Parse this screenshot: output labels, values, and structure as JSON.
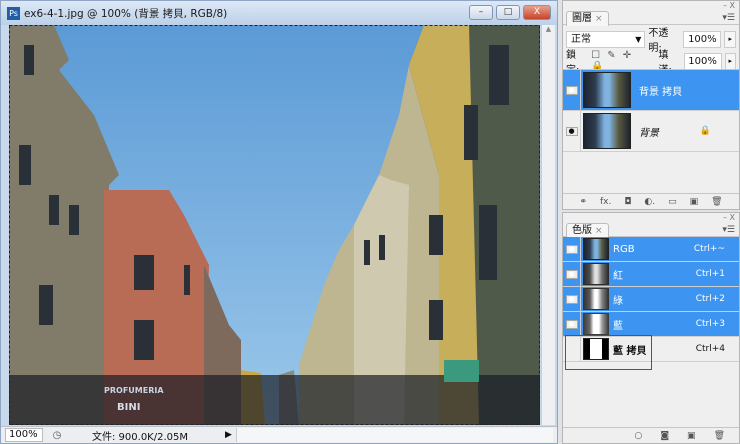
{
  "document": {
    "title": "ex6-4-1.jpg @ 100% (背景 拷貝, RGB/8)",
    "app_icon": "Ps",
    "window_buttons": {
      "minimize": "–",
      "maximize": "□",
      "close": "X"
    },
    "status": {
      "zoom": "100%",
      "info": "文件: 900.0K/2.05M",
      "arrow": "▶"
    },
    "photo_signs": [
      "PROFUMERIA",
      "BINI"
    ]
  },
  "layers_panel": {
    "tab": "圖層",
    "close": "×",
    "collapse": "– X",
    "blend_mode": "正常",
    "opacity_label": "不透明:",
    "opacity": "100%",
    "lock_label": "鎖定:",
    "lock_icons": "☐ ✎ ✛ 🔒",
    "fill_label": "填滿:",
    "fill": "100%",
    "layers": [
      {
        "name": "背景 拷貝",
        "visible": true,
        "selected": true
      },
      {
        "name": "背景",
        "visible": true,
        "locked": true,
        "lock_icon": "🔒"
      }
    ],
    "footer_icons": [
      "link-icon",
      "fx-icon",
      "mask-icon",
      "adjustment-icon",
      "folder-icon",
      "new-layer-icon",
      "trash-icon"
    ],
    "footer_glyphs": [
      "⚭",
      "fx.",
      "◘",
      "◐.",
      "▭",
      "▣",
      "🗑"
    ]
  },
  "channels_panel": {
    "tab": "色版",
    "close": "×",
    "collapse": "– X",
    "channels": [
      {
        "name": "RGB",
        "shortcut": "Ctrl+~",
        "selected": true
      },
      {
        "name": "紅",
        "shortcut": "Ctrl+1",
        "selected": true
      },
      {
        "name": "綠",
        "shortcut": "Ctrl+2",
        "selected": true
      },
      {
        "name": "藍",
        "shortcut": "Ctrl+3",
        "selected": true
      },
      {
        "name": "藍 拷貝",
        "shortcut": "Ctrl+4",
        "selected": false
      }
    ],
    "footer_glyphs": [
      "○",
      "◙",
      "▣",
      "🗑"
    ],
    "highlight_color": "#d0202a",
    "selection_color": "#3e95f1"
  }
}
